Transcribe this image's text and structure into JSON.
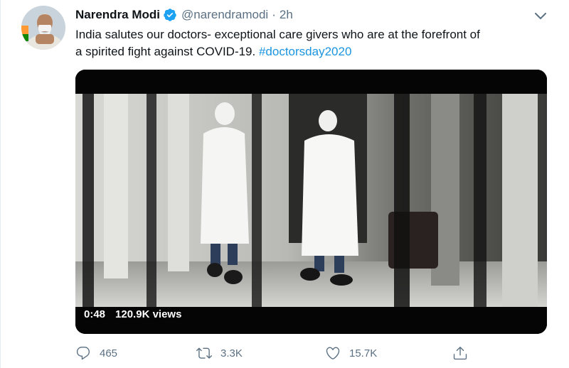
{
  "tweet": {
    "author_name": "Narendra Modi",
    "handle": "@narendramodi",
    "separator": "·",
    "time": "2h",
    "text_line1": "India salutes our doctors- exceptional care givers  who are at the forefront of",
    "text_line2": "a spirited fight against COVID-19. ",
    "hashtag": "#doctorsday2020",
    "verified": true
  },
  "video": {
    "duration": "0:48",
    "views": "120.9K views"
  },
  "actions": {
    "reply_count": "465",
    "retweet_count": "3.3K",
    "like_count": "15.7K"
  },
  "icons": {
    "verified": "verified-badge-icon",
    "caret": "chevron-down-icon",
    "reply": "reply-icon",
    "retweet": "retweet-icon",
    "like": "heart-icon",
    "share": "share-icon"
  },
  "colors": {
    "link": "#1b95e0",
    "verified": "#1da1f2",
    "muted": "#5b7083",
    "text": "#0f1419"
  }
}
